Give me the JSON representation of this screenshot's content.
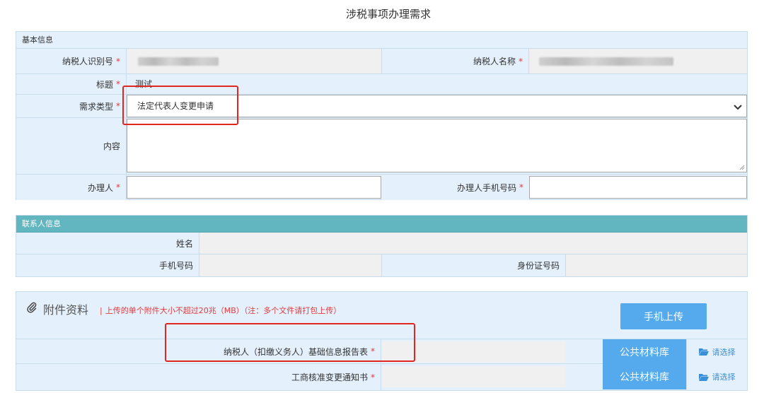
{
  "page": {
    "title": "涉税事项办理需求"
  },
  "basic_info": {
    "section_title": "基本信息",
    "taxpayer_id_label": "纳税人识别号",
    "taxpayer_name_label": "纳税人名称",
    "title_label": "标题",
    "title_value": "测试",
    "request_type_label": "需求类型",
    "request_type_value": "法定代表人变更申请",
    "content_label": "内容",
    "content_value": "",
    "handler_label": "办理人",
    "handler_value": "",
    "handler_phone_label": "办理人手机号码",
    "handler_phone_value": "",
    "required_mark": "*"
  },
  "contact_info": {
    "section_title": "联系人信息",
    "name_label": "姓名",
    "phone_label": "手机号码",
    "id_label": "身份证号码"
  },
  "attachments": {
    "title": "附件资料",
    "note_bar": "|",
    "note": "上传的单个附件大小不超过20兆（MB）（注：多个文件请打包上传）",
    "mobile_upload_label": "手机上传",
    "items": [
      {
        "label": "纳税人（扣缴义务人）基础信息报告表",
        "required": "*",
        "library_label": "公共材料库",
        "choose_label": "请选择"
      },
      {
        "label": "工商核准变更通知书",
        "required": "*",
        "library_label": "公共材料库",
        "choose_label": "请选择"
      }
    ]
  },
  "icons": {
    "paperclip": "paperclip-icon",
    "folder": "folder-open-icon",
    "dropdown": "chevron-down-icon"
  },
  "colors": {
    "section_bg": "#e4f0fb",
    "teal_header": "#62b6bf",
    "button_blue": "#55aaee",
    "required_red": "#e4393c",
    "highlight_red": "#e0261f"
  }
}
